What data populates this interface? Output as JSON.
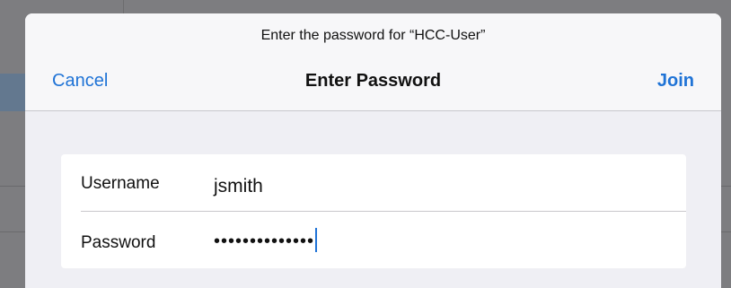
{
  "dialog": {
    "prompt": "Enter the password for “HCC-User”",
    "title": "Enter Password",
    "cancel_label": "Cancel",
    "join_label": "Join"
  },
  "form": {
    "username_label": "Username",
    "username_value": "jsmith",
    "password_label": "Password",
    "password_value": "••••••••••••••"
  },
  "colors": {
    "accent": "#1f73d6",
    "sheet_background": "#efeff4",
    "dim_backdrop": "#7d7d80"
  }
}
